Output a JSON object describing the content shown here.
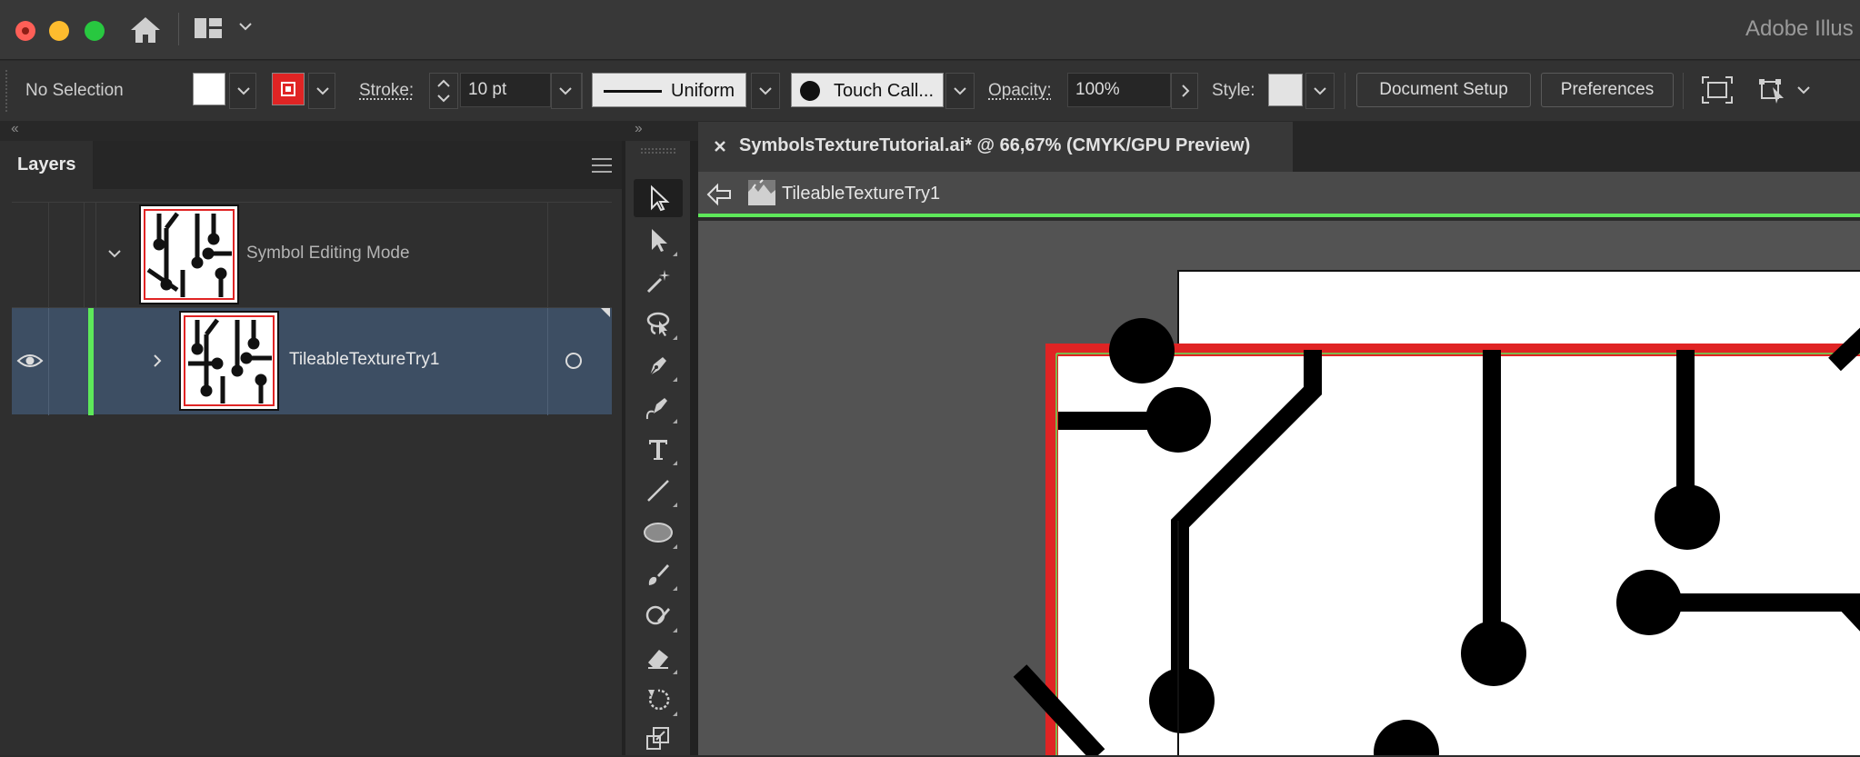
{
  "app": {
    "title": "Adobe Illus"
  },
  "control_bar": {
    "selection_status": "No Selection",
    "fill_color": "#ffffff",
    "stroke_color": "#e02424",
    "stroke_label": "Stroke:",
    "stroke_weight": "10 pt",
    "variable_width_profile": "Uniform",
    "brush_name": "Touch Call...",
    "opacity_label": "Opacity:",
    "opacity_value": "100%",
    "style_label": "Style:",
    "document_setup_label": "Document Setup",
    "preferences_label": "Preferences"
  },
  "layers_panel": {
    "tab_label": "Layers",
    "rows": [
      {
        "name": "Symbol Editing Mode",
        "expanded": true,
        "selected": false
      },
      {
        "name": "TileableTextureTry1",
        "expanded": false,
        "selected": true,
        "visible": true,
        "layer_color": "#5ee85a"
      }
    ]
  },
  "toolbar": {
    "tools": [
      "selection-tool",
      "direct-selection-tool",
      "magic-wand-tool",
      "lasso-tool",
      "pen-tool",
      "curvature-tool",
      "type-tool",
      "line-segment-tool",
      "ellipse-tool",
      "paintbrush-tool",
      "shaper-tool",
      "eraser-tool",
      "rotate-tool",
      "scale-tool"
    ],
    "active_tool": "selection-tool"
  },
  "document": {
    "tab_title": "SymbolsTextureTutorial.ai* @ 66,67% (CMYK/GPU Preview)",
    "isolation_breadcrumb": "TileableTextureTry1"
  },
  "colors": {
    "isolation_bar_border": "#5ee85a",
    "selection_row": "#3d4e63",
    "artboard_edge": "#e02424"
  }
}
